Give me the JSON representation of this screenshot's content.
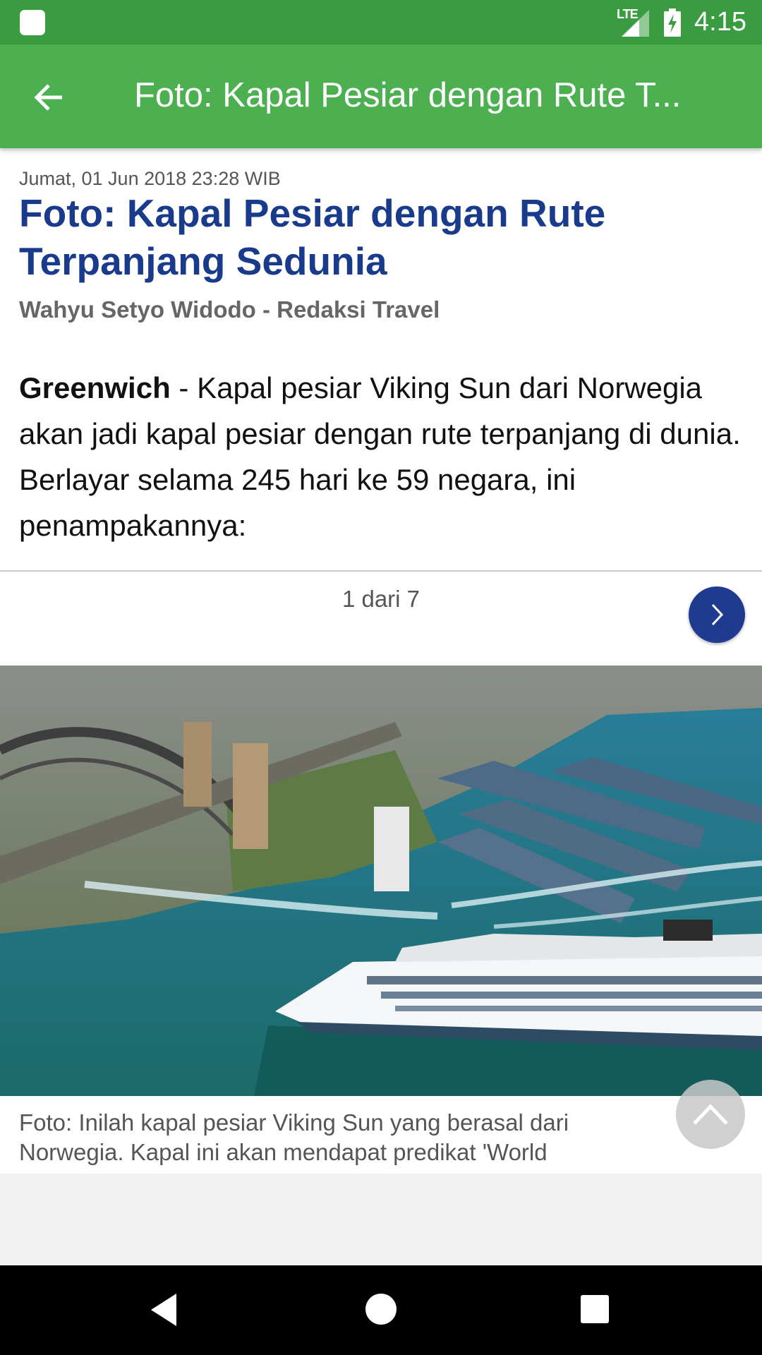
{
  "status_bar": {
    "time": "4:15",
    "network": "LTE",
    "icons": [
      "notification-icon",
      "signal-icon",
      "battery-charging-icon"
    ]
  },
  "app_bar": {
    "title": "Foto: Kapal Pesiar dengan Rute T..."
  },
  "article": {
    "date": "Jumat, 01 Jun 2018 23:28 WIB",
    "headline": "Foto: Kapal Pesiar dengan Rute Terpanjang Sedunia",
    "author": "Wahyu Setyo Widodo - Redaksi Travel",
    "lead_location": "Greenwich",
    "lead_text": " - Kapal pesiar Viking Sun dari Norwegia akan jadi kapal pesiar dengan rute terpanjang di dunia. Berlayar selama 245 hari ke 59 negara, ini penampakannya:"
  },
  "gallery": {
    "pager": "1 dari 7",
    "caption": "Foto:  Inilah kapal pesiar Viking Sun yang berasal dari Norwegia. Kapal ini akan mendapat predikat  'World"
  },
  "colors": {
    "status_bar": "#3a9c40",
    "app_bar": "#4caf50",
    "headline": "#1a3b8c",
    "next_button": "#1f3a8f"
  }
}
